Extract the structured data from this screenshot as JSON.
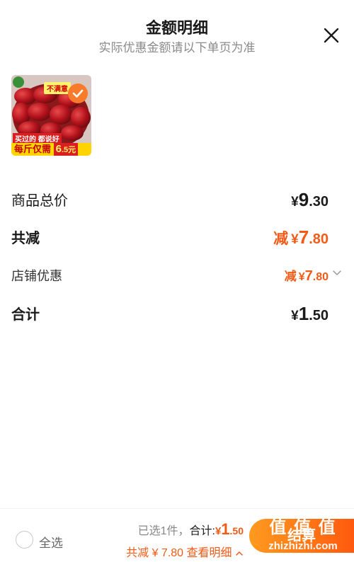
{
  "header": {
    "title": "金额明细",
    "subtitle": "实际优惠金额请以下单页为准"
  },
  "product": {
    "image_alt": "red dates",
    "promo_top": "不满意",
    "promo_mid": "买过的 都说好",
    "promo_bottom_prefix": "每斤仅需",
    "promo_price_int": "6",
    "promo_price_dec": ".5元",
    "selected": true
  },
  "rows": {
    "total_price": {
      "label": "商品总价",
      "cur": "¥",
      "int": "9",
      "dec": ".30"
    },
    "reduced": {
      "label": "共减",
      "pre": "减",
      "cur": "¥",
      "int": "7",
      "dec": ".80"
    },
    "shop_discount": {
      "label": "店铺优惠",
      "pre": "减",
      "cur": "¥",
      "int": "7",
      "dec": ".80"
    },
    "sum": {
      "label": "合计",
      "cur": "¥",
      "int": "1",
      "dec": ".50"
    }
  },
  "bottom_bar": {
    "select_all": "全选",
    "selected_count": "已选1件，",
    "total_label": "合计:",
    "total_cur": "¥",
    "total_int": "1",
    "total_dec": ".50",
    "discount_label": "共减 ¥ 7.80",
    "detail_label": "查看明细",
    "checkout": "结算",
    "watermark_line1": "值 值 值",
    "watermark_line2": "zhizhizhi.com"
  },
  "colors": {
    "accent": "#f35a16",
    "checkout_gradient_start": "#ff9a1f",
    "checkout_gradient_end": "#ff5a0f"
  }
}
